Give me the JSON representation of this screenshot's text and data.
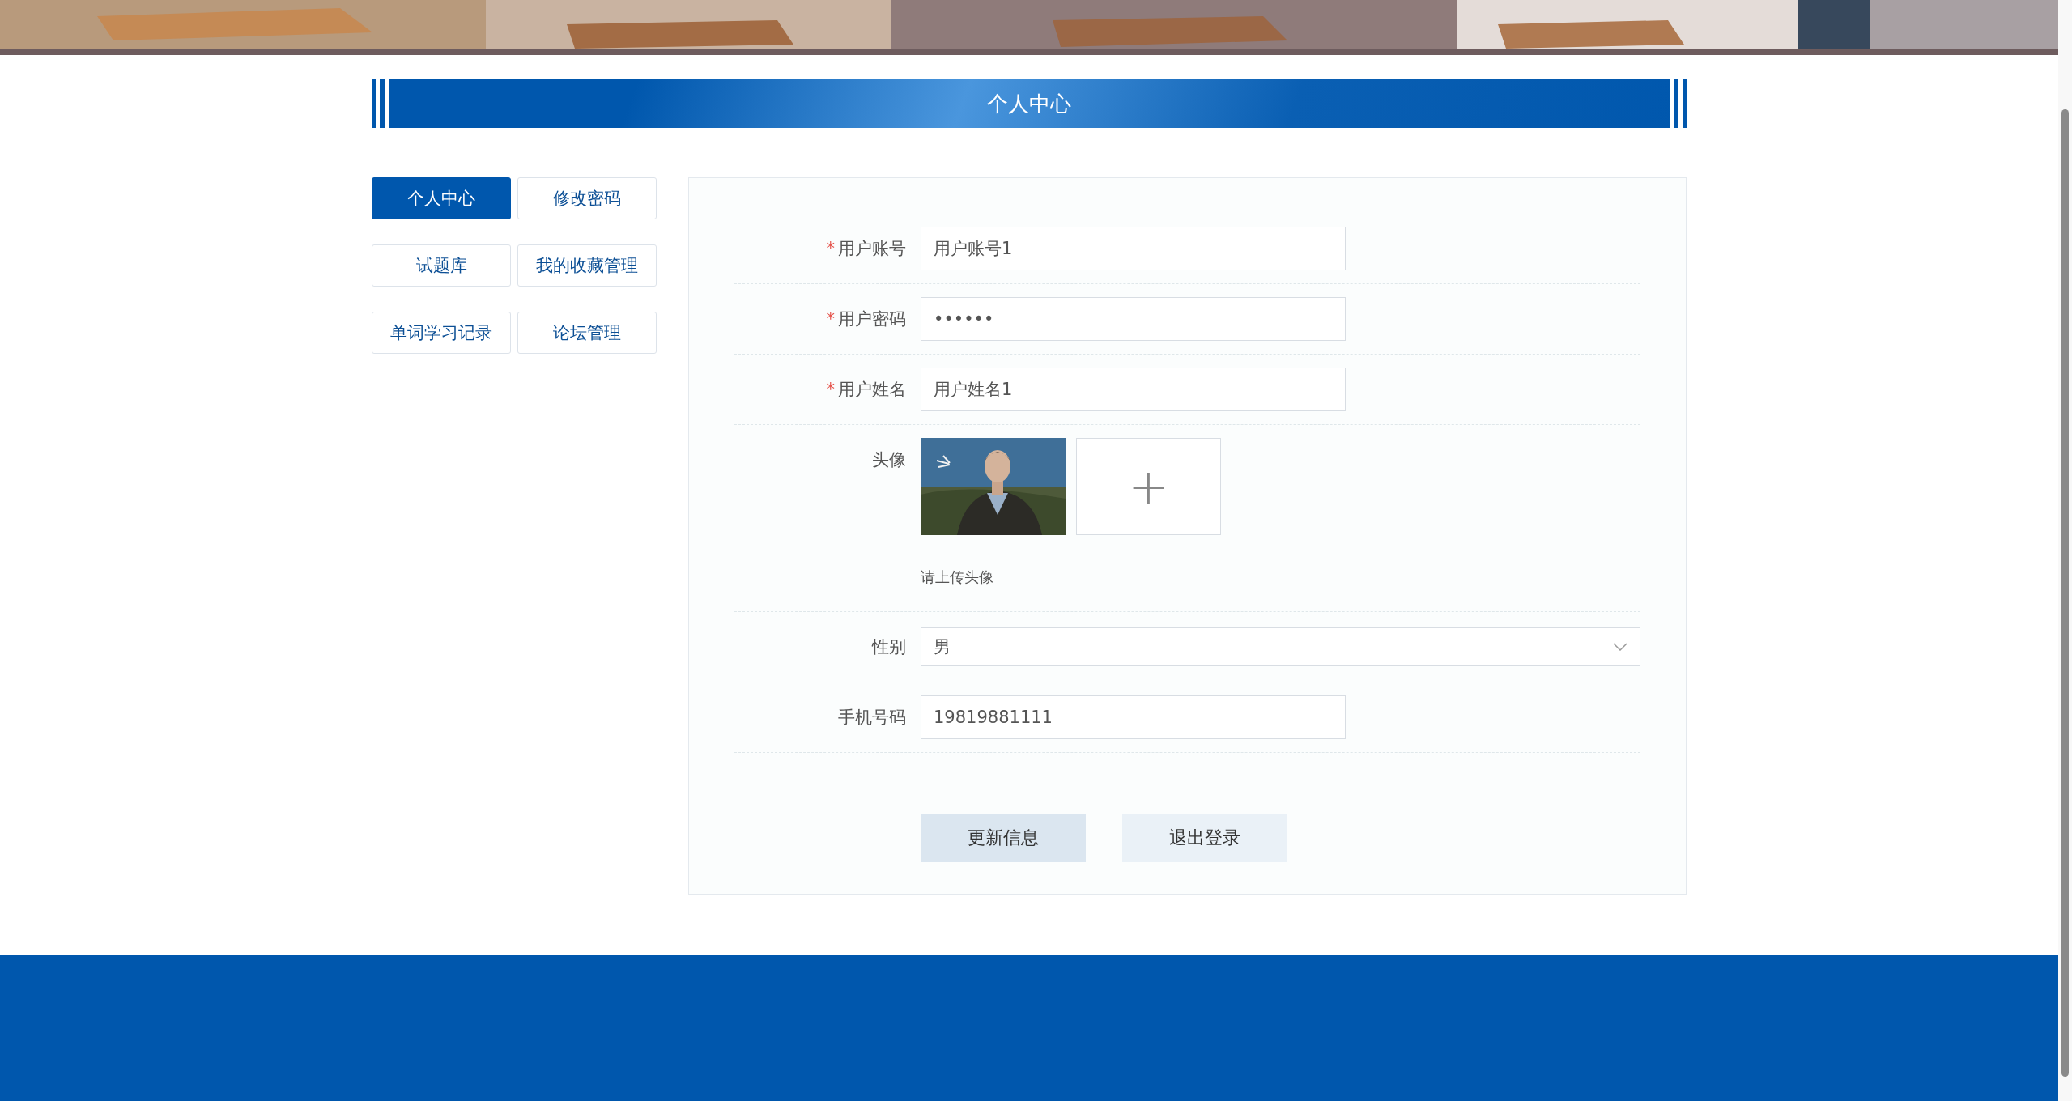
{
  "page_title": "个人中心",
  "nav": [
    {
      "label": "个人中心",
      "selected": true
    },
    {
      "label": "修改密码",
      "selected": false
    },
    {
      "label": "试题库",
      "selected": false
    },
    {
      "label": "我的收藏管理",
      "selected": false
    },
    {
      "label": "单词学习记录",
      "selected": false
    },
    {
      "label": "论坛管理",
      "selected": false
    }
  ],
  "form": {
    "fields": [
      {
        "kind": "text",
        "label": "用户账号",
        "required_mark": "*",
        "value": "用户账号1"
      },
      {
        "kind": "password",
        "label": "用户密码",
        "required_mark": "*",
        "value": "••••••"
      },
      {
        "kind": "text",
        "label": "用户姓名",
        "required_mark": "*",
        "value": "用户姓名1"
      },
      {
        "kind": "upload",
        "label": "头像",
        "hint": "请上传头像",
        "add_symbol": "+"
      },
      {
        "kind": "select",
        "label": "性别",
        "value": "男"
      },
      {
        "kind": "text",
        "label": "手机号码",
        "value": "19819881111"
      }
    ],
    "buttons": [
      {
        "label": "更新信息",
        "kind": "primary"
      },
      {
        "label": "退出登录",
        "kind": "secondary"
      }
    ]
  }
}
